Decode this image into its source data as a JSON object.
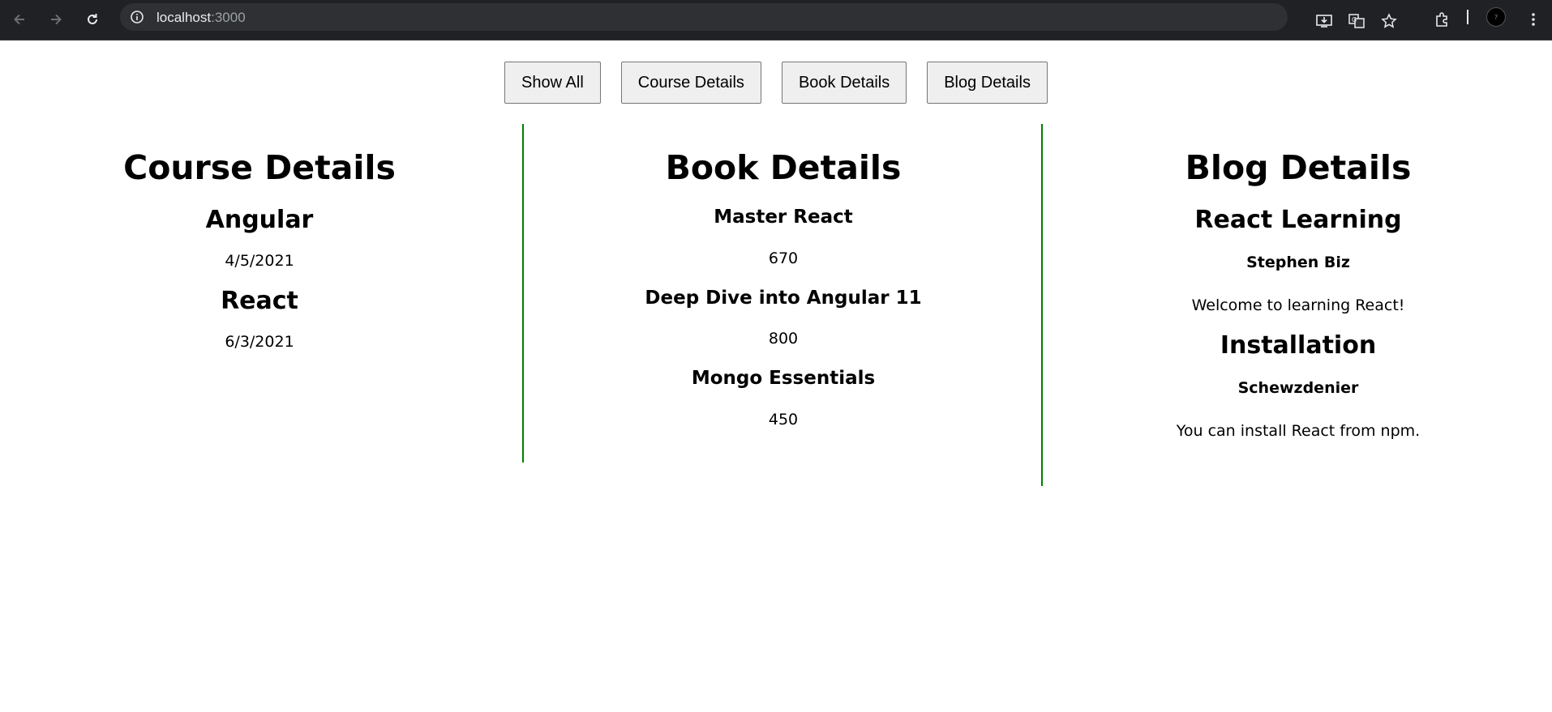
{
  "browser": {
    "url_host": "localhost",
    "url_port": ":3000"
  },
  "toolbar": {
    "show_all_label": "Show All",
    "course_details_label": "Course Details",
    "book_details_label": "Book Details",
    "blog_details_label": "Blog Details"
  },
  "course": {
    "title": "Course Details",
    "items": [
      {
        "name": "Angular",
        "date": "4/5/2021"
      },
      {
        "name": "React",
        "date": "6/3/2021"
      }
    ]
  },
  "book": {
    "title": "Book Details",
    "items": [
      {
        "name": "Master React",
        "price": "670"
      },
      {
        "name": "Deep Dive into Angular 11",
        "price": "800"
      },
      {
        "name": "Mongo Essentials",
        "price": "450"
      }
    ]
  },
  "blog": {
    "title": "Blog Details",
    "items": [
      {
        "title": "React Learning",
        "author": "Stephen Biz",
        "content": "Welcome to learning React!"
      },
      {
        "title": "Installation",
        "author": "Schewzdenier",
        "content": "You can install React from npm."
      }
    ]
  },
  "colors": {
    "divider": "#008000",
    "browser_chrome": "#202124"
  }
}
